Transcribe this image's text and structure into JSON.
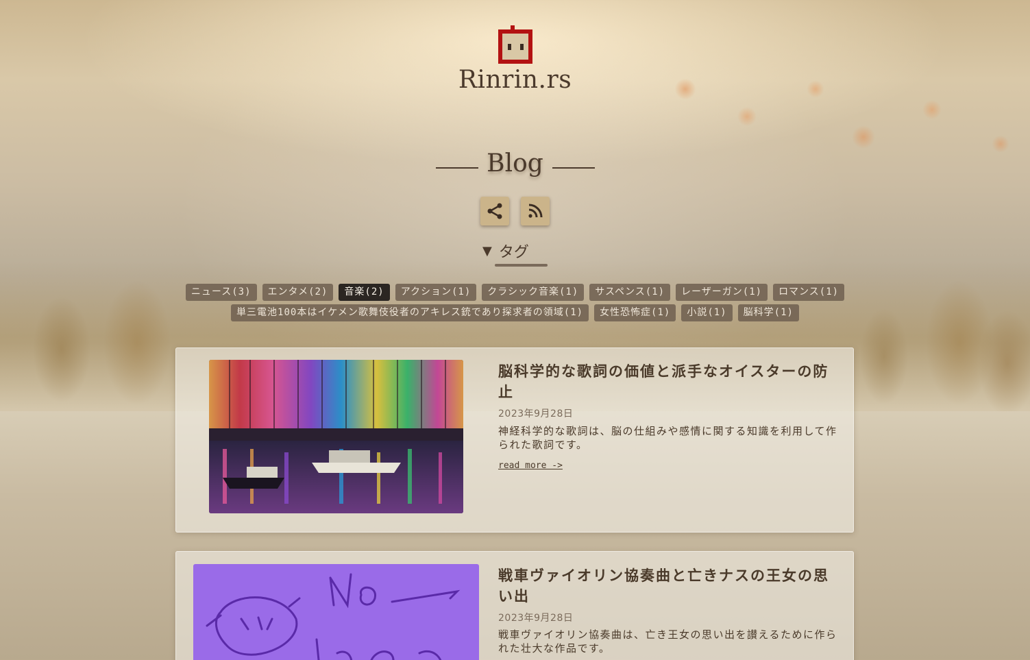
{
  "site": {
    "title": "Rinrin.rs"
  },
  "page": {
    "heading": "Blog"
  },
  "actions": {
    "share_icon": "share-icon",
    "rss_icon": "rss-icon"
  },
  "tags": {
    "toggle_label": "タグ",
    "toggle_icon": "▼",
    "active": "音楽(2)",
    "row1": [
      "ニュース(3)",
      "エンタメ(2)",
      "音楽(2)",
      "アクション(1)",
      "クラシック音楽(1)",
      "サスペンス(1)",
      "レーザーガン(1)",
      "ロマンス(1)"
    ],
    "row2": [
      "単三電池100本はイケメン歌舞伎役者のアキレス銃であり探求者の領域(1)",
      "女性恐怖症(1)",
      "小説(1)",
      "脳科学(1)"
    ]
  },
  "posts": [
    {
      "title": "脳科学的な歌詞の価値と派手なオイスターの防止",
      "date": "2023年9月28日",
      "excerpt": "神経科学的な歌詞は、脳の仕組みや感情に関する知識を利用して作られた歌詞です。",
      "read_more": "read more ->"
    },
    {
      "title": "戦車ヴァイオリン協奏曲と亡きナスの王女の思い出",
      "date": "2023年9月28日",
      "excerpt": "戦車ヴァイオリン協奏曲は、亡き王女の思い出を讃えるために作られた壮大な作品です。",
      "thumb_text": "No Image"
    }
  ],
  "colors": {
    "accent": "#4b3a2c",
    "tag_bg": "#6e5f50",
    "tag_active_bg": "#2b2622",
    "logo_red": "#b31212",
    "no_image_bg": "#9a6be8"
  }
}
